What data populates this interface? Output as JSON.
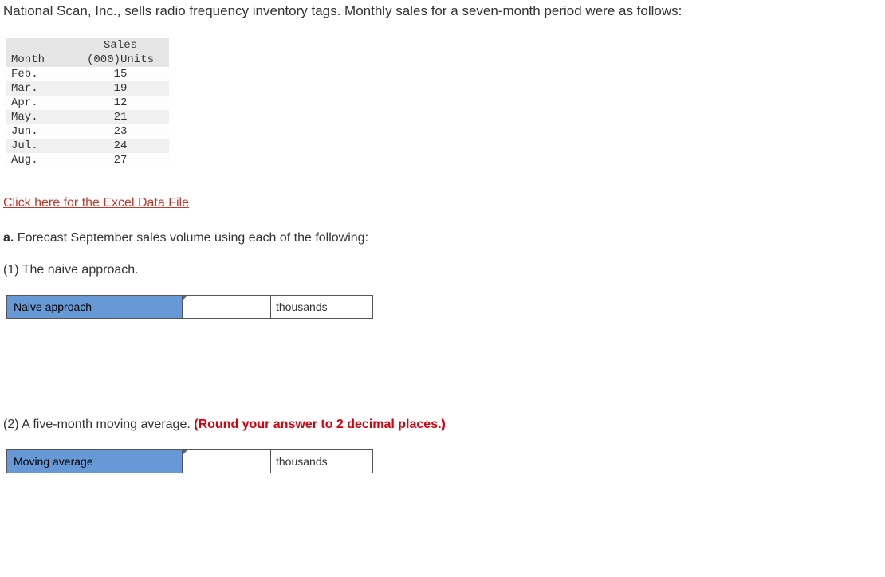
{
  "intro": "National Scan, Inc., sells radio frequency inventory tags. Monthly sales for a seven-month period were as follows:",
  "table": {
    "header_month": "Month",
    "header_sales_line1": "Sales",
    "header_sales_line2": "(000)Units",
    "rows": [
      {
        "month": "Feb.",
        "sales": "15"
      },
      {
        "month": "Mar.",
        "sales": "19"
      },
      {
        "month": "Apr.",
        "sales": "12"
      },
      {
        "month": "May.",
        "sales": "21"
      },
      {
        "month": "Jun.",
        "sales": "23"
      },
      {
        "month": "Jul.",
        "sales": "24"
      },
      {
        "month": "Aug.",
        "sales": "27"
      }
    ]
  },
  "excel_link": "Click here for the Excel Data File",
  "part_a": {
    "label": "a.",
    "text": " Forecast September sales volume using each of the following:"
  },
  "q1": {
    "heading": "(1) The naive approach.",
    "label": "Naive approach",
    "unit": "thousands"
  },
  "q2": {
    "heading_plain": "(2) A five-month moving average. ",
    "heading_hint": "(Round your answer to 2 decimal places.)",
    "label": "Moving average",
    "unit": "thousands"
  }
}
